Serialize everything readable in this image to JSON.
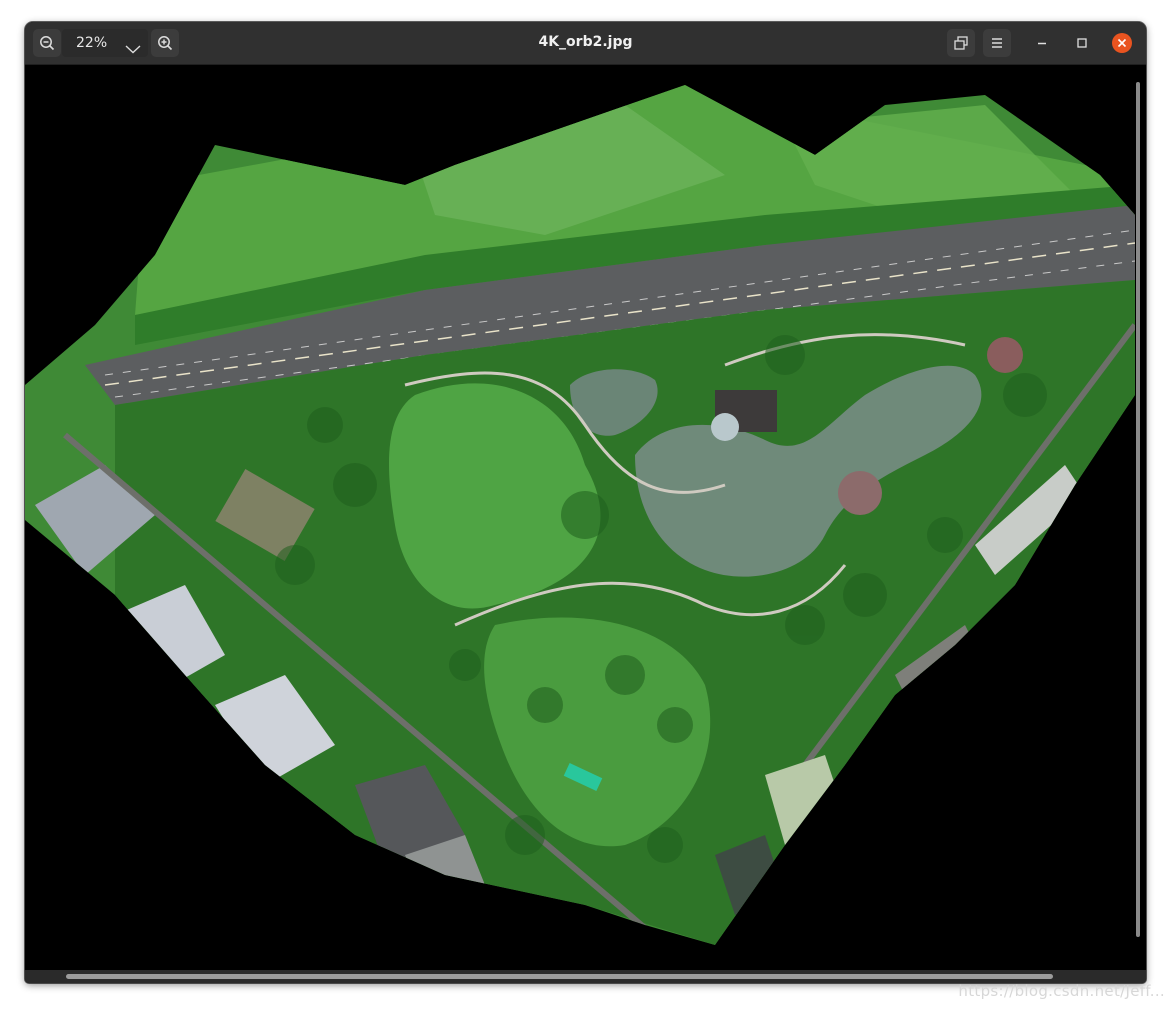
{
  "window": {
    "title": "4K_orb2.jpg",
    "zoom_value": "22%"
  },
  "icons": {
    "zoom_out": "zoom-out-icon",
    "zoom_in": "zoom-in-icon",
    "zoom_dropdown": "chevron-down-icon",
    "fullscreen": "fullscreen-icon",
    "menu": "hamburger-menu-icon",
    "minimize": "minimize-icon",
    "maximize": "maximize-icon",
    "close": "close-icon"
  },
  "colors": {
    "headerbar": "#303030",
    "close_button": "#e95420",
    "background": "#000000"
  },
  "watermark": "https://blog.csdn.net/Jeff..."
}
